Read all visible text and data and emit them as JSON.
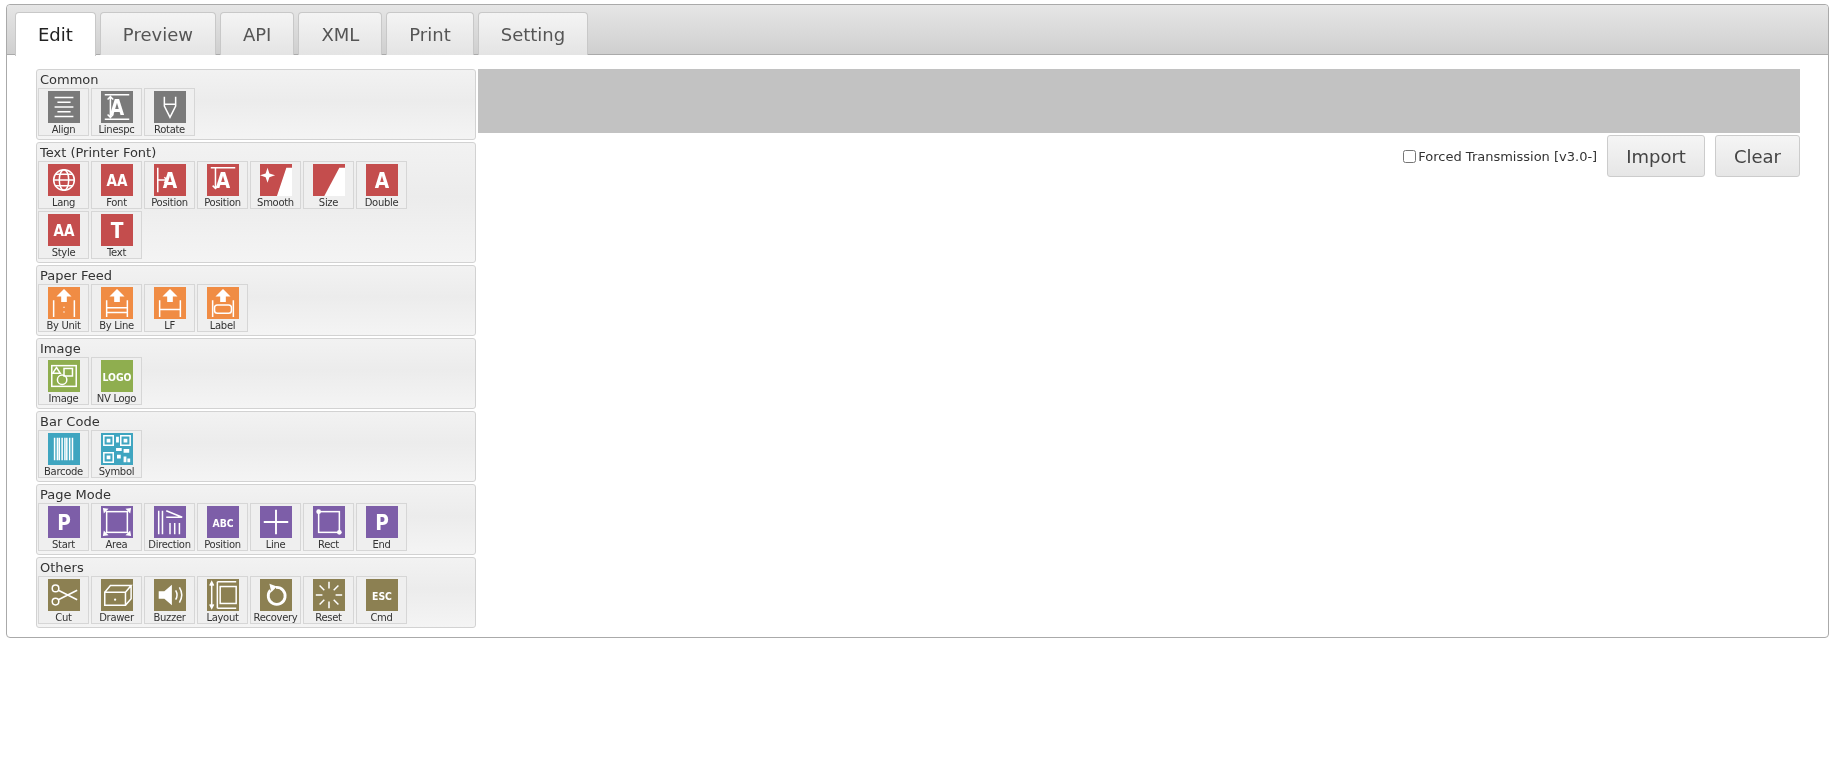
{
  "tabs": [
    {
      "label": "Edit",
      "selected": true
    },
    {
      "label": "Preview",
      "selected": false
    },
    {
      "label": "API",
      "selected": false
    },
    {
      "label": "XML",
      "selected": false
    },
    {
      "label": "Print",
      "selected": false
    },
    {
      "label": "Setting",
      "selected": false
    }
  ],
  "palette": [
    {
      "title": "Common",
      "color": "#7a7a7a",
      "buttons": [
        {
          "label": "Align"
        },
        {
          "label": "Linespc",
          "glyph": "A"
        },
        {
          "label": "Rotate"
        }
      ]
    },
    {
      "title": "Text (Printer Font)",
      "color": "#c44d4d",
      "buttons": [
        {
          "label": "Lang"
        },
        {
          "label": "Font",
          "glyph": "AA"
        },
        {
          "label": "Position",
          "glyph": "A"
        },
        {
          "label": "Position",
          "glyph": "A"
        },
        {
          "label": "Smooth"
        },
        {
          "label": "Size"
        },
        {
          "label": "Double",
          "glyph": "A"
        },
        {
          "label": "Style",
          "glyph": "AA"
        },
        {
          "label": "Text",
          "glyph": "T"
        }
      ]
    },
    {
      "title": "Paper Feed",
      "color": "#f08c44",
      "buttons": [
        {
          "label": "By Unit"
        },
        {
          "label": "By Line"
        },
        {
          "label": "LF"
        },
        {
          "label": "Label"
        }
      ]
    },
    {
      "title": "Image",
      "color": "#8fae4f",
      "buttons": [
        {
          "label": "Image"
        },
        {
          "label": "NV Logo",
          "glyph": "LOGO"
        }
      ]
    },
    {
      "title": "Bar Code",
      "color": "#3fa5c0",
      "buttons": [
        {
          "label": "Barcode"
        },
        {
          "label": "Symbol"
        }
      ]
    },
    {
      "title": "Page Mode",
      "color": "#7d5ea8",
      "buttons": [
        {
          "label": "Start",
          "glyph": "P"
        },
        {
          "label": "Area"
        },
        {
          "label": "Direction"
        },
        {
          "label": "Position",
          "glyph": "ABC"
        },
        {
          "label": "Line"
        },
        {
          "label": "Rect"
        },
        {
          "label": "End",
          "glyph": "P"
        }
      ]
    },
    {
      "title": "Others",
      "color": "#8c8052",
      "buttons": [
        {
          "label": "Cut"
        },
        {
          "label": "Drawer"
        },
        {
          "label": "Buzzer"
        },
        {
          "label": "Layout"
        },
        {
          "label": "Recovery"
        },
        {
          "label": "Reset"
        },
        {
          "label": "Cmd",
          "glyph": "ESC"
        }
      ]
    }
  ],
  "forced_transmission": {
    "label": "Forced Transmission [v3.0-]",
    "checked": false
  },
  "buttons": [
    "Import",
    "Clear"
  ]
}
